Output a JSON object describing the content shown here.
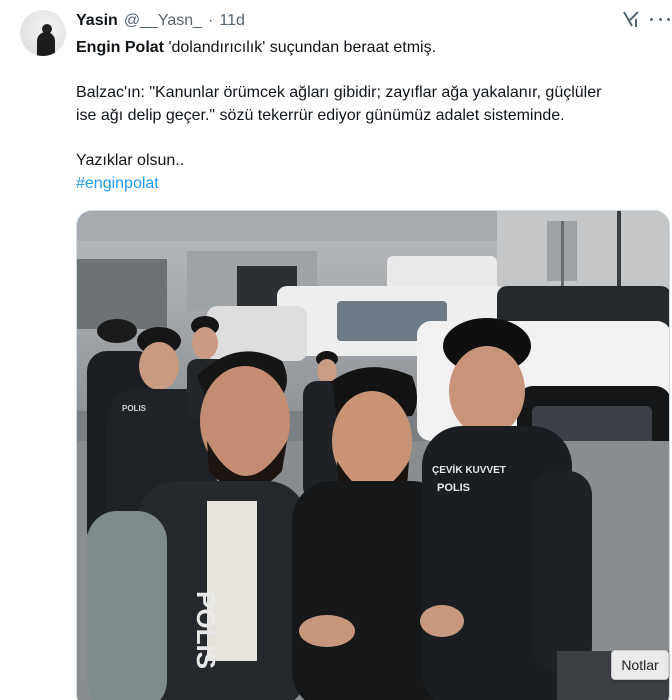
{
  "tweet": {
    "author": {
      "display_name": "Yasin",
      "handle": "@__Yasn_",
      "separator": "·",
      "time": "11d"
    },
    "line1_name": "Engin Polat",
    "line1_rest": " 'dolandırıcılık' suçundan beraat etmiş.",
    "line2a": "Balzac'ın: \"Kanunlar örümcek ağları gibidir; zayıflar ağa yakalanır, güçlüler",
    "line2b": "ise ağı delip geçer.\" sözü tekerrür ediyor günümüz adalet sisteminde.",
    "line3": "Yazıklar olsun..",
    "hashtag": "#enginpolat",
    "photo_badge_1": "ÇEVİK KUVVET",
    "photo_badge_2": "POLIS",
    "photo_badge_3": "POLIS",
    "photo_vest_text": "POLIS"
  },
  "tooltip": {
    "label": "Notlar"
  },
  "icons": [
    "grok-icon",
    "more-icon"
  ]
}
